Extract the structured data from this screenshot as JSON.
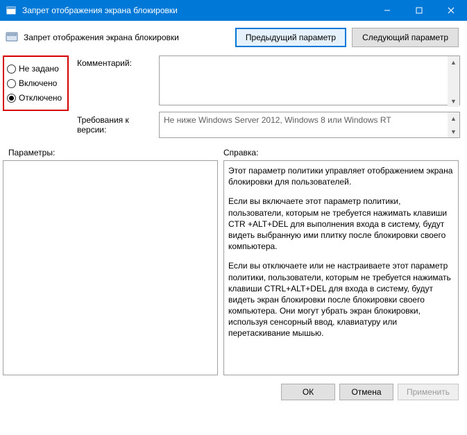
{
  "window": {
    "title": "Запрет отображения экрана блокировки"
  },
  "header": {
    "title": "Запрет отображения экрана блокировки",
    "prev": "Предыдущий параметр",
    "next": "Следующий параметр"
  },
  "radios": {
    "not_configured": "Не задано",
    "enabled": "Включено",
    "disabled": "Отключено",
    "selected": "disabled"
  },
  "labels": {
    "comment": "Комментарий:",
    "requirements": "Требования к версии:",
    "params": "Параметры:",
    "help": "Справка:"
  },
  "fields": {
    "comment_value": "",
    "requirements_value": "Не ниже Windows Server 2012, Windows 8 или Windows RT"
  },
  "help": {
    "p1": "Этот параметр политики управляет отображением экрана блокировки для пользователей.",
    "p2": "Если вы включаете этот параметр политики, пользователи, которым не требуется нажимать клавиши CTR +ALT+DEL для выполнения входа в систему, будут видеть выбранную ими плитку после блокировки своего компьютера.",
    "p3": "Если вы отключаете или не настраиваете этот параметр политики, пользователи, которым не требуется нажимать клавиши CTRL+ALT+DEL для входа в систему, будут видеть экран блокировки после блокировки своего компьютера. Они могут убрать экран блокировки, используя сенсорный ввод, клавиатуру или перетаскивание мышью."
  },
  "footer": {
    "ok": "ОК",
    "cancel": "Отмена",
    "apply": "Применить"
  }
}
